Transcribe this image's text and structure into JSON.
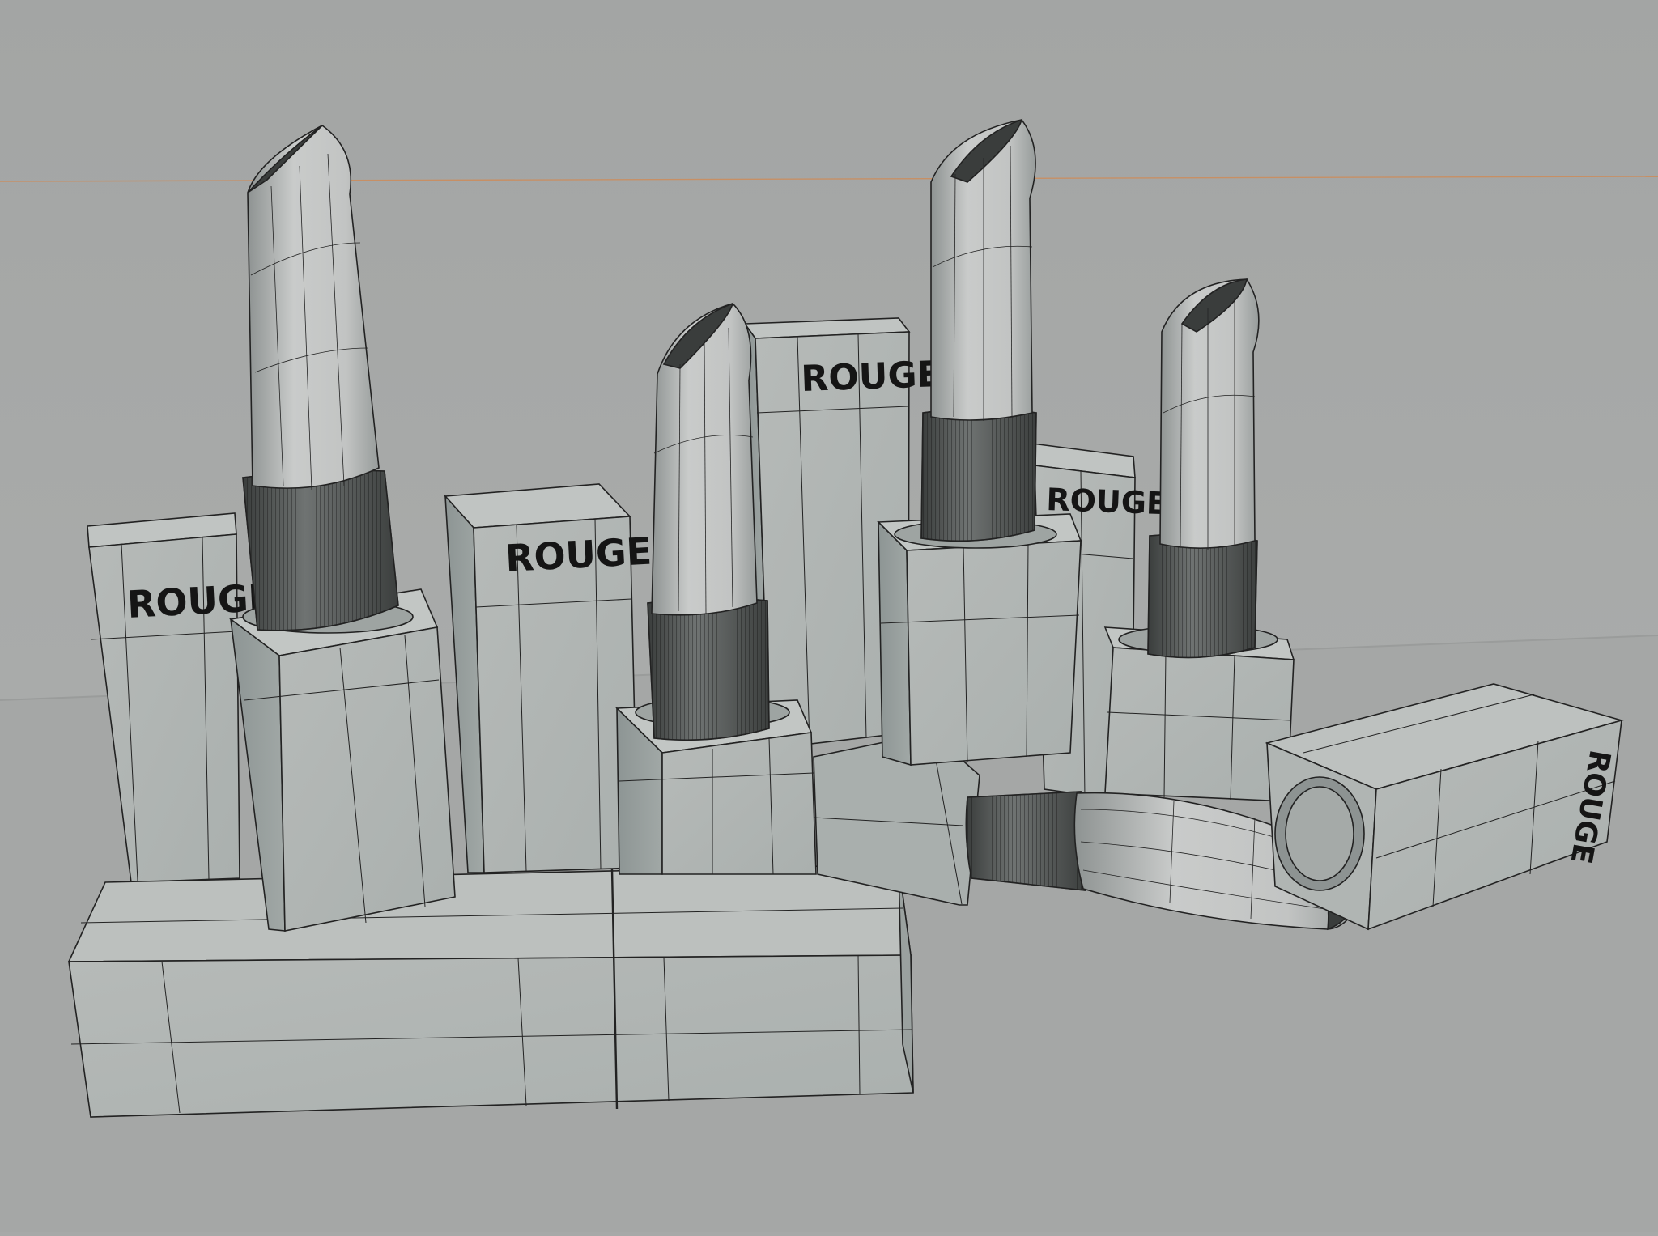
{
  "scene": {
    "type": "3d-wireframe-render",
    "subject": "lipsticks",
    "count": 6,
    "palette": {
      "background": "#a7a9a8",
      "floor": "#a5a7a6",
      "case": "#b3b7b5",
      "case_shadow": "#8f9594",
      "bullet": "#c4c6c5",
      "band": "#5e6261",
      "wire": "#222222",
      "horizon_line": "#d08a55"
    }
  },
  "labels": {
    "rouge_1": "ROUGE",
    "rouge_2": "ROUGE",
    "rouge_3": "ROUGE",
    "rouge_4": "ROUGE",
    "rouge_5": "ROUGE"
  }
}
